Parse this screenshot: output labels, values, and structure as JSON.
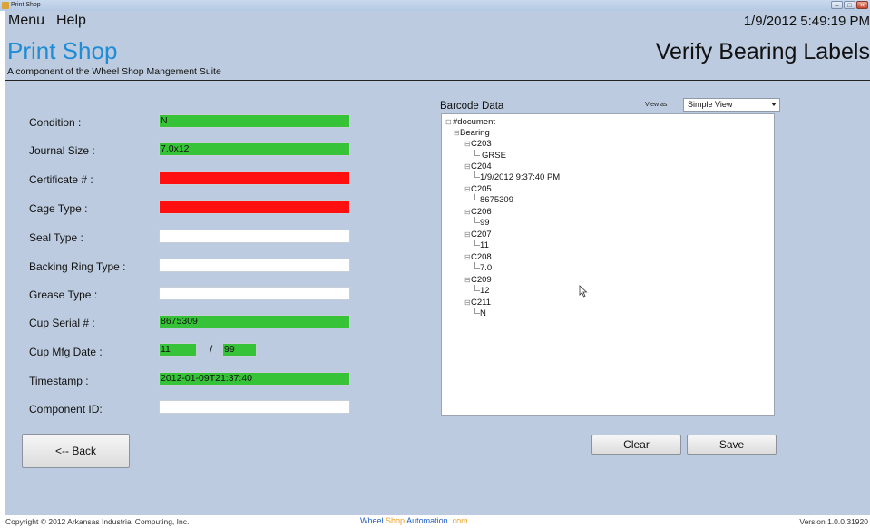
{
  "window": {
    "title": "Print Shop"
  },
  "menu": {
    "items": [
      "Menu",
      "Help"
    ],
    "datetime": "1/9/2012 5:49:19 PM"
  },
  "header": {
    "app_title": "Print Shop",
    "subtitle": "A component of the Wheel Shop Mangement Suite",
    "page_title": "Verify Bearing Labels"
  },
  "colors": {
    "valid": "#37c337",
    "invalid": "#ff0f0f",
    "empty": "#ffffff",
    "brand_blue": "#1f8cd6",
    "brand_orange": "#f0a020"
  },
  "fields": {
    "condition": {
      "label": "Condition :",
      "value": "N",
      "status": "valid"
    },
    "journal_size": {
      "label": "Journal Size :",
      "value": "7.0x12",
      "status": "valid"
    },
    "certificate": {
      "label": "Certificate # :",
      "value": "",
      "status": "invalid"
    },
    "cage_type": {
      "label": "Cage Type :",
      "value": "",
      "status": "invalid"
    },
    "seal_type": {
      "label": "Seal Type :",
      "value": "",
      "status": "empty"
    },
    "backing_ring_type": {
      "label": "Backing Ring Type :",
      "value": "",
      "status": "empty"
    },
    "grease_type": {
      "label": "Grease Type :",
      "value": "",
      "status": "empty"
    },
    "cup_serial": {
      "label": "Cup Serial # :",
      "value": "8675309",
      "status": "valid"
    },
    "cup_mfg_date": {
      "label": "Cup Mfg Date :",
      "month": "11",
      "separator": "/",
      "year": "99",
      "status": "valid"
    },
    "timestamp": {
      "label": "Timestamp :",
      "value": "2012-01-09T21:37:40",
      "status": "valid"
    },
    "component_id": {
      "label": "Component ID:",
      "value": "",
      "status": "empty"
    }
  },
  "buttons": {
    "back": "<-- Back",
    "clear": "Clear",
    "save": "Save"
  },
  "barcode": {
    "label": "Barcode Data",
    "view_as_label": "View as",
    "view_as_value": "Simple View",
    "tree": {
      "document": "#document",
      "bearing": "Bearing",
      "nodes": [
        {
          "code": "C203",
          "value": "GRSE"
        },
        {
          "code": "C204",
          "value": "1/9/2012 9:37:40 PM"
        },
        {
          "code": "C205",
          "value": "8675309"
        },
        {
          "code": "C206",
          "value": "99"
        },
        {
          "code": "C207",
          "value": "11"
        },
        {
          "code": "C208",
          "value": "7.0"
        },
        {
          "code": "C209",
          "value": "12"
        },
        {
          "code": "C211",
          "value": "N"
        }
      ]
    }
  },
  "footer": {
    "copyright": "Copyright © 2012 Arkansas Industrial Computing, Inc.",
    "brand": {
      "part1": "Wheel",
      "part2": "Shop",
      "part3": "Automation",
      "part4": ".com"
    },
    "version": "Version 1.0.0.31920"
  }
}
